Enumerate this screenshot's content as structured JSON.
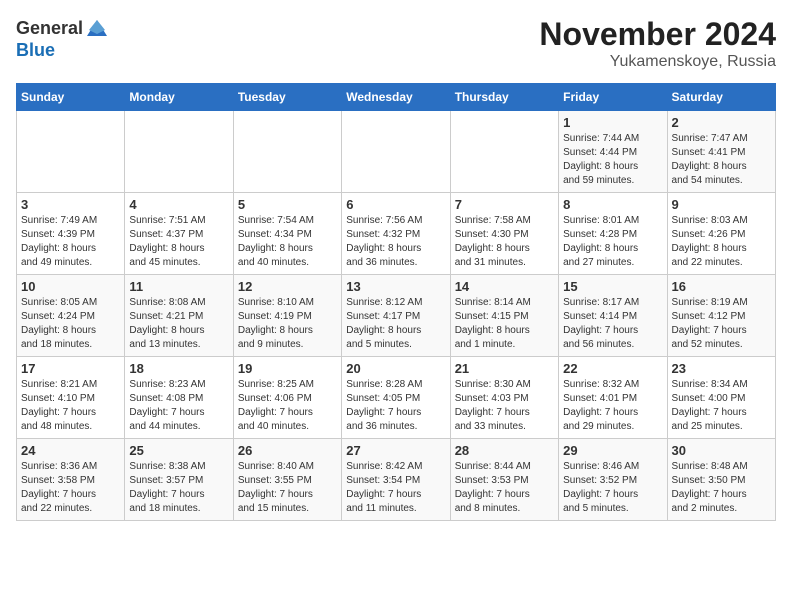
{
  "header": {
    "logo_general": "General",
    "logo_blue": "Blue",
    "month": "November 2024",
    "location": "Yukamenskoye, Russia"
  },
  "weekdays": [
    "Sunday",
    "Monday",
    "Tuesday",
    "Wednesday",
    "Thursday",
    "Friday",
    "Saturday"
  ],
  "weeks": [
    [
      {
        "day": "",
        "info": ""
      },
      {
        "day": "",
        "info": ""
      },
      {
        "day": "",
        "info": ""
      },
      {
        "day": "",
        "info": ""
      },
      {
        "day": "",
        "info": ""
      },
      {
        "day": "1",
        "info": "Sunrise: 7:44 AM\nSunset: 4:44 PM\nDaylight: 8 hours\nand 59 minutes."
      },
      {
        "day": "2",
        "info": "Sunrise: 7:47 AM\nSunset: 4:41 PM\nDaylight: 8 hours\nand 54 minutes."
      }
    ],
    [
      {
        "day": "3",
        "info": "Sunrise: 7:49 AM\nSunset: 4:39 PM\nDaylight: 8 hours\nand 49 minutes."
      },
      {
        "day": "4",
        "info": "Sunrise: 7:51 AM\nSunset: 4:37 PM\nDaylight: 8 hours\nand 45 minutes."
      },
      {
        "day": "5",
        "info": "Sunrise: 7:54 AM\nSunset: 4:34 PM\nDaylight: 8 hours\nand 40 minutes."
      },
      {
        "day": "6",
        "info": "Sunrise: 7:56 AM\nSunset: 4:32 PM\nDaylight: 8 hours\nand 36 minutes."
      },
      {
        "day": "7",
        "info": "Sunrise: 7:58 AM\nSunset: 4:30 PM\nDaylight: 8 hours\nand 31 minutes."
      },
      {
        "day": "8",
        "info": "Sunrise: 8:01 AM\nSunset: 4:28 PM\nDaylight: 8 hours\nand 27 minutes."
      },
      {
        "day": "9",
        "info": "Sunrise: 8:03 AM\nSunset: 4:26 PM\nDaylight: 8 hours\nand 22 minutes."
      }
    ],
    [
      {
        "day": "10",
        "info": "Sunrise: 8:05 AM\nSunset: 4:24 PM\nDaylight: 8 hours\nand 18 minutes."
      },
      {
        "day": "11",
        "info": "Sunrise: 8:08 AM\nSunset: 4:21 PM\nDaylight: 8 hours\nand 13 minutes."
      },
      {
        "day": "12",
        "info": "Sunrise: 8:10 AM\nSunset: 4:19 PM\nDaylight: 8 hours\nand 9 minutes."
      },
      {
        "day": "13",
        "info": "Sunrise: 8:12 AM\nSunset: 4:17 PM\nDaylight: 8 hours\nand 5 minutes."
      },
      {
        "day": "14",
        "info": "Sunrise: 8:14 AM\nSunset: 4:15 PM\nDaylight: 8 hours\nand 1 minute."
      },
      {
        "day": "15",
        "info": "Sunrise: 8:17 AM\nSunset: 4:14 PM\nDaylight: 7 hours\nand 56 minutes."
      },
      {
        "day": "16",
        "info": "Sunrise: 8:19 AM\nSunset: 4:12 PM\nDaylight: 7 hours\nand 52 minutes."
      }
    ],
    [
      {
        "day": "17",
        "info": "Sunrise: 8:21 AM\nSunset: 4:10 PM\nDaylight: 7 hours\nand 48 minutes."
      },
      {
        "day": "18",
        "info": "Sunrise: 8:23 AM\nSunset: 4:08 PM\nDaylight: 7 hours\nand 44 minutes."
      },
      {
        "day": "19",
        "info": "Sunrise: 8:25 AM\nSunset: 4:06 PM\nDaylight: 7 hours\nand 40 minutes."
      },
      {
        "day": "20",
        "info": "Sunrise: 8:28 AM\nSunset: 4:05 PM\nDaylight: 7 hours\nand 36 minutes."
      },
      {
        "day": "21",
        "info": "Sunrise: 8:30 AM\nSunset: 4:03 PM\nDaylight: 7 hours\nand 33 minutes."
      },
      {
        "day": "22",
        "info": "Sunrise: 8:32 AM\nSunset: 4:01 PM\nDaylight: 7 hours\nand 29 minutes."
      },
      {
        "day": "23",
        "info": "Sunrise: 8:34 AM\nSunset: 4:00 PM\nDaylight: 7 hours\nand 25 minutes."
      }
    ],
    [
      {
        "day": "24",
        "info": "Sunrise: 8:36 AM\nSunset: 3:58 PM\nDaylight: 7 hours\nand 22 minutes."
      },
      {
        "day": "25",
        "info": "Sunrise: 8:38 AM\nSunset: 3:57 PM\nDaylight: 7 hours\nand 18 minutes."
      },
      {
        "day": "26",
        "info": "Sunrise: 8:40 AM\nSunset: 3:55 PM\nDaylight: 7 hours\nand 15 minutes."
      },
      {
        "day": "27",
        "info": "Sunrise: 8:42 AM\nSunset: 3:54 PM\nDaylight: 7 hours\nand 11 minutes."
      },
      {
        "day": "28",
        "info": "Sunrise: 8:44 AM\nSunset: 3:53 PM\nDaylight: 7 hours\nand 8 minutes."
      },
      {
        "day": "29",
        "info": "Sunrise: 8:46 AM\nSunset: 3:52 PM\nDaylight: 7 hours\nand 5 minutes."
      },
      {
        "day": "30",
        "info": "Sunrise: 8:48 AM\nSunset: 3:50 PM\nDaylight: 7 hours\nand 2 minutes."
      }
    ]
  ]
}
